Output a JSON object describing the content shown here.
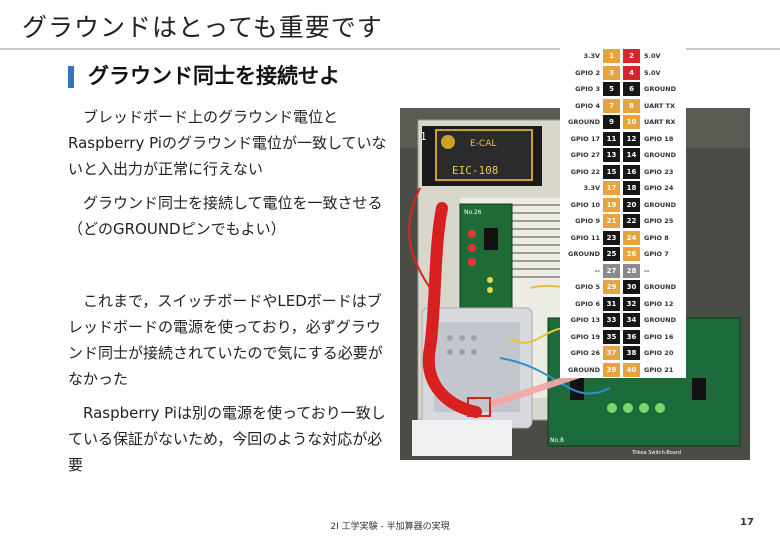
{
  "slide": {
    "title": "グラウンドはとっても重要です",
    "subtitle": "グラウンド同士を接続せよ",
    "paragraphs": [
      "　ブレッドボード上のグラウンド電位とRaspberry Piのグラウンド電位が一致していないと入出力が正常に行えない",
      "　グラウンド同士を接続して電位を一致させる（どのGROUNDピンでもよい）",
      "　これまで，スイッチボードやLEDボードはブレッドボードの電源を使っており，必ずグラウンド同士が接続されていたので気にする必要がなかった",
      "　Raspberry Piは別の電源を使っており一致している保証がないため，今回のような対応が必要"
    ],
    "footer": "2I 工学実験 - 半加算器の実現",
    "page_number": "17"
  },
  "photo_labels": {
    "board_id": "1",
    "board_text": "EIC-108",
    "top_label": "E-CAL",
    "switch_board_label": "No.26",
    "led_board_label": "No.8",
    "led_board_name": "Trikea Switch-Board"
  },
  "colors": {
    "power": "#e8a33c",
    "v5": "#d8252a",
    "ground": "#161616",
    "dnc": "#8a8a8a",
    "accent": "#3a6fc4",
    "wire": "#d7201f"
  },
  "pinout": [
    {
      "l": "3.3V",
      "n1": "1",
      "c1": "power",
      "n2": "2",
      "c2": "v5",
      "r": "5.0V"
    },
    {
      "l": "GPIO 2",
      "n1": "3",
      "c1": "power",
      "n2": "4",
      "c2": "v5",
      "r": "5.0V"
    },
    {
      "l": "GPIO 3",
      "n1": "5",
      "c1": "ground",
      "n2": "6",
      "c2": "ground",
      "r": "GROUND"
    },
    {
      "l": "GPIO 4",
      "n1": "7",
      "c1": "power",
      "n2": "8",
      "c2": "power",
      "r": "UART TX"
    },
    {
      "l": "GROUND",
      "n1": "9",
      "c1": "ground",
      "n2": "10",
      "c2": "power",
      "r": "UART RX"
    },
    {
      "l": "GPIO 17",
      "n1": "11",
      "c1": "ground",
      "n2": "12",
      "c2": "ground",
      "r": "GPIO 18"
    },
    {
      "l": "GPIO 27",
      "n1": "13",
      "c1": "ground",
      "n2": "14",
      "c2": "ground",
      "r": "GROUND"
    },
    {
      "l": "GPIO 22",
      "n1": "15",
      "c1": "ground",
      "n2": "16",
      "c2": "ground",
      "r": "GPIO 23"
    },
    {
      "l": "3.3V",
      "n1": "17",
      "c1": "power",
      "n2": "18",
      "c2": "ground",
      "r": "GPIO 24"
    },
    {
      "l": "GPIO 10",
      "n1": "19",
      "c1": "power",
      "n2": "20",
      "c2": "ground",
      "r": "GROUND"
    },
    {
      "l": "GPIO 9",
      "n1": "21",
      "c1": "power",
      "n2": "22",
      "c2": "ground",
      "r": "GPIO 25"
    },
    {
      "l": "GPIO 11",
      "n1": "23",
      "c1": "ground",
      "n2": "24",
      "c2": "power",
      "r": "GPIO 8"
    },
    {
      "l": "GROUND",
      "n1": "25",
      "c1": "ground",
      "n2": "26",
      "c2": "power",
      "r": "GPIO 7"
    },
    {
      "l": "--",
      "n1": "27",
      "c1": "dnc",
      "n2": "28",
      "c2": "dnc",
      "r": "--"
    },
    {
      "l": "GPIO 5",
      "n1": "29",
      "c1": "power",
      "n2": "30",
      "c2": "ground",
      "r": "GROUND"
    },
    {
      "l": "GPIO 6",
      "n1": "31",
      "c1": "ground",
      "n2": "32",
      "c2": "ground",
      "r": "GPIO 12"
    },
    {
      "l": "GPIO 13",
      "n1": "33",
      "c1": "ground",
      "n2": "34",
      "c2": "ground",
      "r": "GROUND"
    },
    {
      "l": "GPIO 19",
      "n1": "35",
      "c1": "ground",
      "n2": "36",
      "c2": "ground",
      "r": "GPIO 16"
    },
    {
      "l": "GPIO 26",
      "n1": "37",
      "c1": "power",
      "n2": "38",
      "c2": "ground",
      "r": "GPIO 20"
    },
    {
      "l": "GROUND",
      "n1": "39",
      "c1": "power",
      "n2": "40",
      "c2": "power",
      "r": "GPIO 21"
    }
  ]
}
